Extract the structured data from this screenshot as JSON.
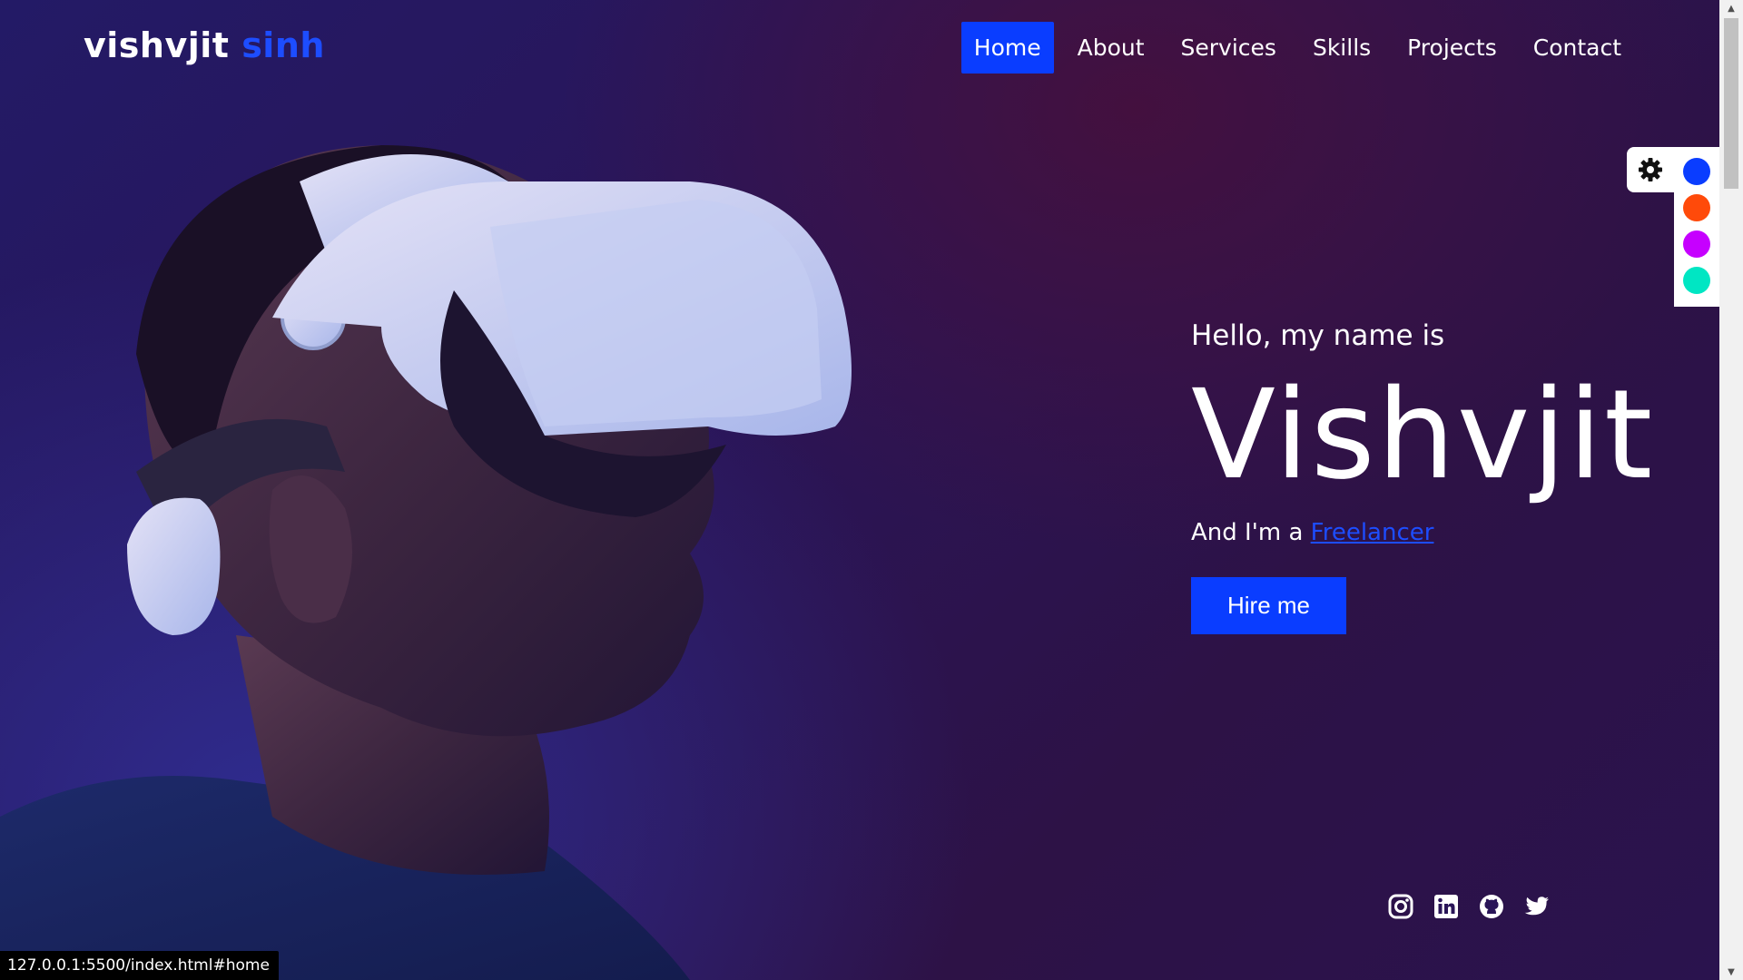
{
  "brand": {
    "first": "vishvjit",
    "second": "sinh",
    "accent_color": "#1d4dff"
  },
  "nav": {
    "items": [
      {
        "label": "Home",
        "active": true
      },
      {
        "label": "About",
        "active": false
      },
      {
        "label": "Services",
        "active": false
      },
      {
        "label": "Skills",
        "active": false
      },
      {
        "label": "Projects",
        "active": false
      },
      {
        "label": "Contact",
        "active": false
      }
    ]
  },
  "hero": {
    "greeting": "Hello, my name is",
    "name": "Vishvjit",
    "role_prefix": "And I'm a ",
    "role": "Freelancer",
    "cta_label": "Hire me",
    "image": "person-with-vr-headset"
  },
  "social": {
    "icons": [
      "instagram-icon",
      "linkedin-icon",
      "github-icon",
      "twitter-icon"
    ]
  },
  "theme_switcher": {
    "icon": "gear-icon",
    "swatches": [
      "#0a3dff",
      "#ff4a0a",
      "#c600ff",
      "#00e6c3"
    ]
  },
  "status_bar": {
    "url": "127.0.0.1:5500/index.html#home"
  }
}
